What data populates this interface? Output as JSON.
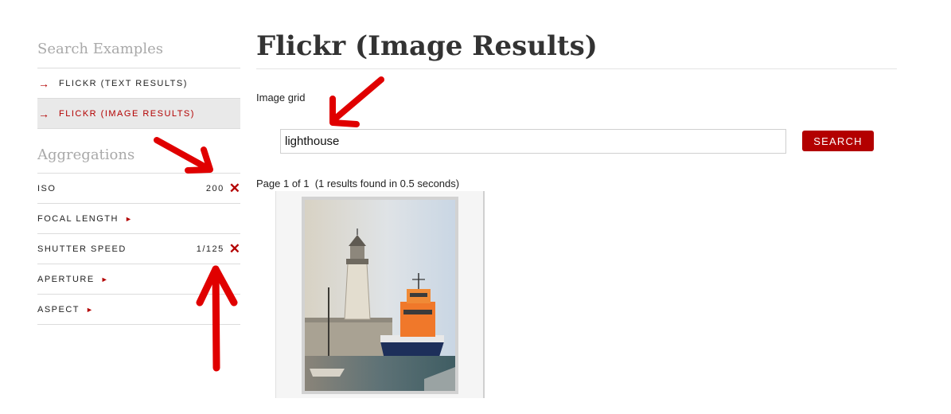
{
  "sidebar": {
    "search_examples_heading": "Search Examples",
    "examples": [
      {
        "label": "FLICKR (TEXT RESULTS)",
        "arrow": "→",
        "active": false
      },
      {
        "label": "FLICKR (IMAGE RESULTS)",
        "arrow": "→",
        "active": true
      }
    ],
    "aggregations_heading": "Aggregations",
    "aggregations": [
      {
        "label": "ISO",
        "value": "200",
        "remove": "✕"
      },
      {
        "label": "FOCAL LENGTH",
        "expand": "►"
      },
      {
        "label": "SHUTTER SPEED",
        "value": "1/125",
        "remove": "✕"
      },
      {
        "label": "APERTURE",
        "expand": "►"
      },
      {
        "label": "ASPECT",
        "expand": "►"
      }
    ]
  },
  "main": {
    "title": "Flickr (Image Results)",
    "grid_label": "Image grid",
    "search": {
      "value": "lighthouse",
      "button_label": "SEARCH"
    },
    "paging": "Page 1 of 1  (1 results found in 0.5 seconds)",
    "results": [
      {
        "image_icon": "lighthouse-lifeboat-photo"
      }
    ]
  },
  "colors": {
    "accent": "#b30000",
    "annotation_arrow": "#e00000",
    "heading_gray": "#a9a9a9"
  }
}
